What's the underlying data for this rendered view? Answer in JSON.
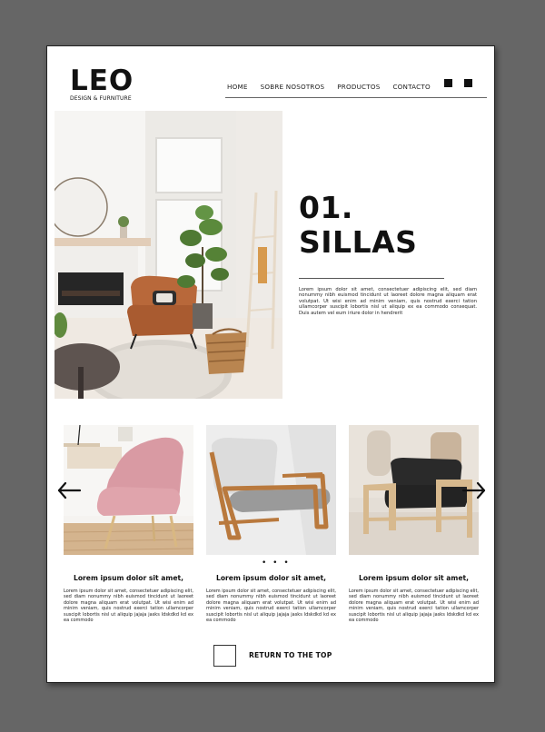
{
  "brand": {
    "name": "LEO",
    "tagline": "DESIGN & FURNITURE"
  },
  "nav": {
    "items": [
      "HOME",
      "SOBRE NOSOTROS",
      "PRODUCTOS",
      "CONTACTO"
    ]
  },
  "hero": {
    "number": "01.",
    "title": "SILLAS",
    "text": "Lorem ipsum dolor sit amet, consectetuer adipiscing elit, sed diam nonummy nibh euismod tincidunt ut laoreet dolore magna aliquam erat volutpat. Ut wisi enim ad minim veniam, quis nostrud exerci tation ullamcorper suscipit lobortis nisl ut aliquip ex ea commodo consequat. Duis autem vel eum iriure dolor in hendrerit"
  },
  "carousel": {
    "dots": "• • •",
    "cards": [
      {
        "title": "Lorem ipsum dolor sit amet,",
        "text": "Lorem ipsum dolor sit amet, consectetuer adipiscing elit, sed diam nonummy nibh euismod tincidunt ut laoreet dolore magna aliquam erat volutpat. Ut wisi enim ad minim veniam, quis nostrud exerci tation ullamcorper suscipit lobortis nisl ut aliquip jajaja jasks ldskdkd kd ex ea commodo"
      },
      {
        "title": "Lorem ipsum dolor sit amet,",
        "text": "Lorem ipsum dolor sit amet, consectetuer adipiscing elit, sed diam nonummy nibh euismod tincidunt ut laoreet dolore magna aliquam erat volutpat. Ut wisi enim ad minim veniam, quis nostrud exerci tation ullamcorper suscipit lobortis nisl ut aliquip jajaja jasks ldskdkd kd ex ea commodo"
      },
      {
        "title": "Lorem ipsum dolor sit amet,",
        "text": "Lorem ipsum dolor sit amet, consectetuer adipiscing elit, sed diam nonummy nibh euismod tincidunt ut laoreet dolore magna aliquam erat volutpat. Ut wisi enim ad minim veniam, quis nostrud exerci tation ullamcorper suscipit lobortis nisl ut aliquip jajaja jasks ldskdkd kd ex ea commodo"
      }
    ]
  },
  "footer": {
    "return_label": "RETURN TO THE TOP"
  },
  "icons": {
    "prev": "arrow-left-icon",
    "next": "arrow-right-icon",
    "top": "return-top-box"
  },
  "colors": {
    "canvas": "#666666",
    "page": "#ffffff",
    "text": "#111111",
    "pink_chair": "#d99aa3",
    "leather_chair": "#b8683a"
  }
}
